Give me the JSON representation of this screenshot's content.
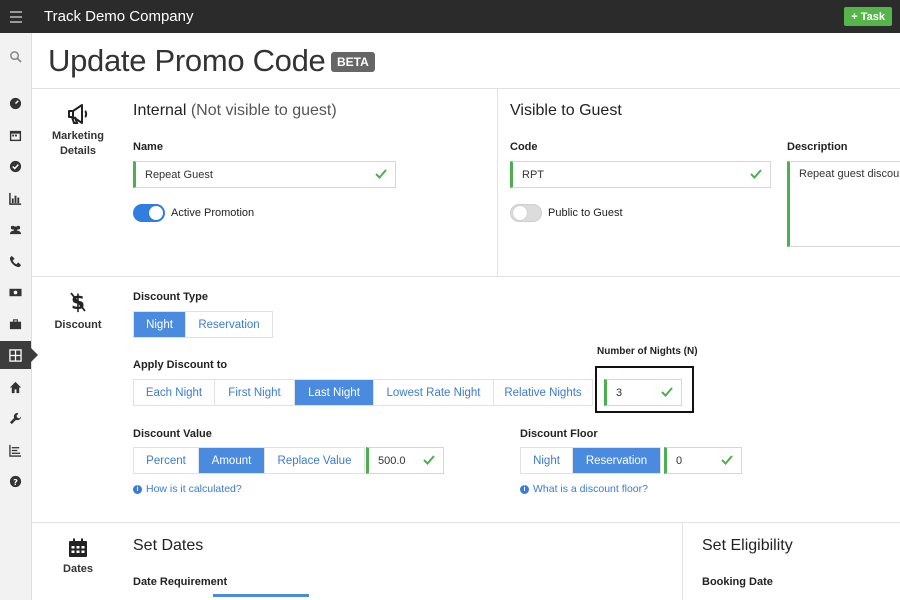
{
  "app": {
    "title": "Track Demo Company",
    "task_button": "Task"
  },
  "page": {
    "title": "Update Promo Code",
    "badge": "BETA"
  },
  "sidebar": {
    "icons": [
      "search-icon",
      "dashboard-icon",
      "calendar-icon",
      "check-icon",
      "reports-icon",
      "people-icon",
      "phone-icon",
      "money-icon",
      "briefcase-icon",
      "grid-icon",
      "home-icon",
      "wrench-icon",
      "list-icon",
      "help-icon"
    ],
    "active": "grid-icon"
  },
  "marketing": {
    "label": "Marketing Details",
    "internal": {
      "heading": "Internal",
      "heading_note": "(Not visible to guest)",
      "name_label": "Name",
      "name_value": "Repeat Guest",
      "active_label": "Active Promotion",
      "active_on": true
    },
    "visible": {
      "heading": "Visible to Guest",
      "code_label": "Code",
      "code_value": "RPT",
      "public_label": "Public to Guest",
      "public_on": false,
      "description_label": "Description",
      "description_value": "Repeat guest discount"
    }
  },
  "discount": {
    "label": "Discount",
    "type_label": "Discount Type",
    "type_options": [
      "Night",
      "Reservation"
    ],
    "type_selected": "Night",
    "apply_label": "Apply Discount to",
    "apply_options": [
      "Each Night",
      "First Night",
      "Last Night",
      "Lowest Rate Night",
      "Relative Nights"
    ],
    "apply_selected": "Last Night",
    "nights_label": "Number of Nights (N)",
    "nights_value": "3",
    "value_label": "Discount Value",
    "value_options": [
      "Percent",
      "Amount",
      "Replace Value"
    ],
    "value_selected": "Amount",
    "value_amount": "500.0",
    "value_help": "How is it calculated?",
    "floor_label": "Discount Floor",
    "floor_options": [
      "Night",
      "Reservation"
    ],
    "floor_selected": "Reservation",
    "floor_value": "0",
    "floor_help": "What is a discount floor?"
  },
  "dates": {
    "label": "Dates",
    "heading": "Set Dates",
    "requirement_label": "Date Requirement"
  },
  "eligibility": {
    "heading": "Set Eligibility",
    "booking_label": "Booking Date"
  },
  "colors": {
    "accent": "#4a8be0",
    "valid": "#4caf50",
    "topbar": "#2b2b2b",
    "task": "#56b548"
  }
}
